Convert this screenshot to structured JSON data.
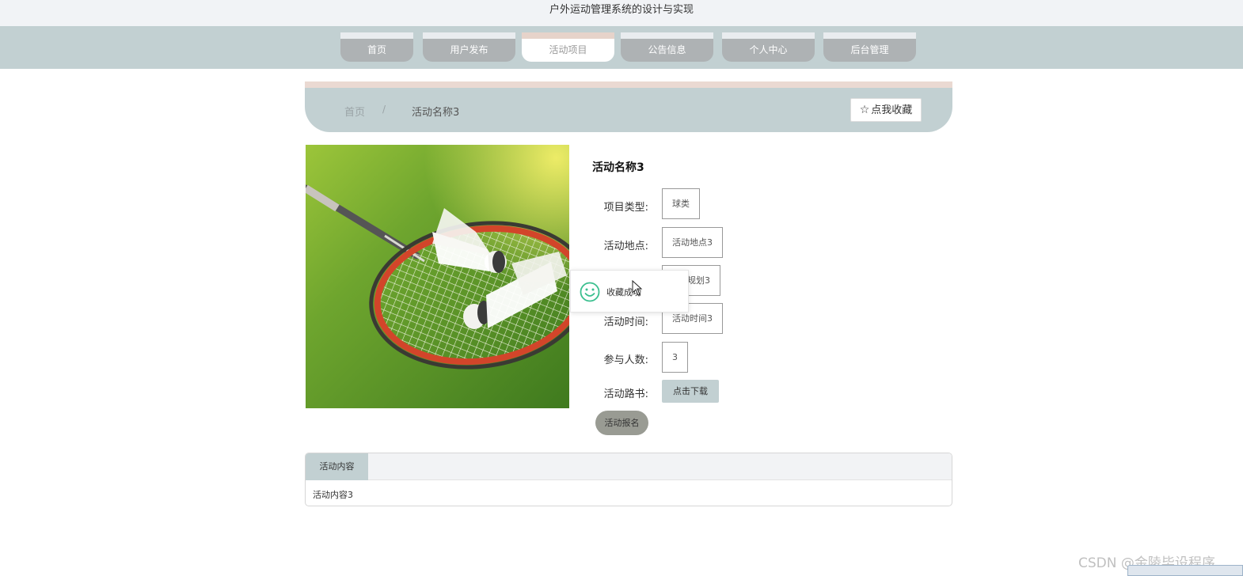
{
  "app": {
    "title": "户外运动管理系统的设计与实现"
  },
  "nav": {
    "items": [
      {
        "label": "首页",
        "active": false
      },
      {
        "label": "用户发布",
        "active": false
      },
      {
        "label": "活动项目",
        "active": true
      },
      {
        "label": "公告信息",
        "active": false
      },
      {
        "label": "个人中心",
        "active": false
      },
      {
        "label": "后台管理",
        "active": false
      }
    ]
  },
  "breadcrumb": {
    "home": "首页",
    "separator": "/",
    "current": "活动名称3"
  },
  "favorite": {
    "icon": "star-outline-icon",
    "label": "点我收藏"
  },
  "detail": {
    "image": "badminton-racket-shuttlecocks-on-grass",
    "name": "活动名称3",
    "fields": [
      {
        "label": "项目类型:",
        "value": "球类"
      },
      {
        "label": "活动地点:",
        "value": "活动地点3"
      },
      {
        "label": "",
        "value": "规划3"
      },
      {
        "label": "活动时间:",
        "value": "活动时间3"
      },
      {
        "label": "参与人数:",
        "value": "3"
      }
    ],
    "route_label": "活动路书:",
    "download_label": "点击下载",
    "signup_label": "活动报名"
  },
  "toast": {
    "icon": "smile-icon",
    "message": "收藏成功"
  },
  "tabs": {
    "active_label": "活动内容",
    "content": "活动内容3"
  },
  "watermark": "CSDN @金陵毕设程序",
  "colors": {
    "nav_bg": "#c2d0d2",
    "tab_inactive": "#aeb2b4",
    "accent_top": "#ead9d2",
    "toast_icon": "#3bbf8f"
  }
}
